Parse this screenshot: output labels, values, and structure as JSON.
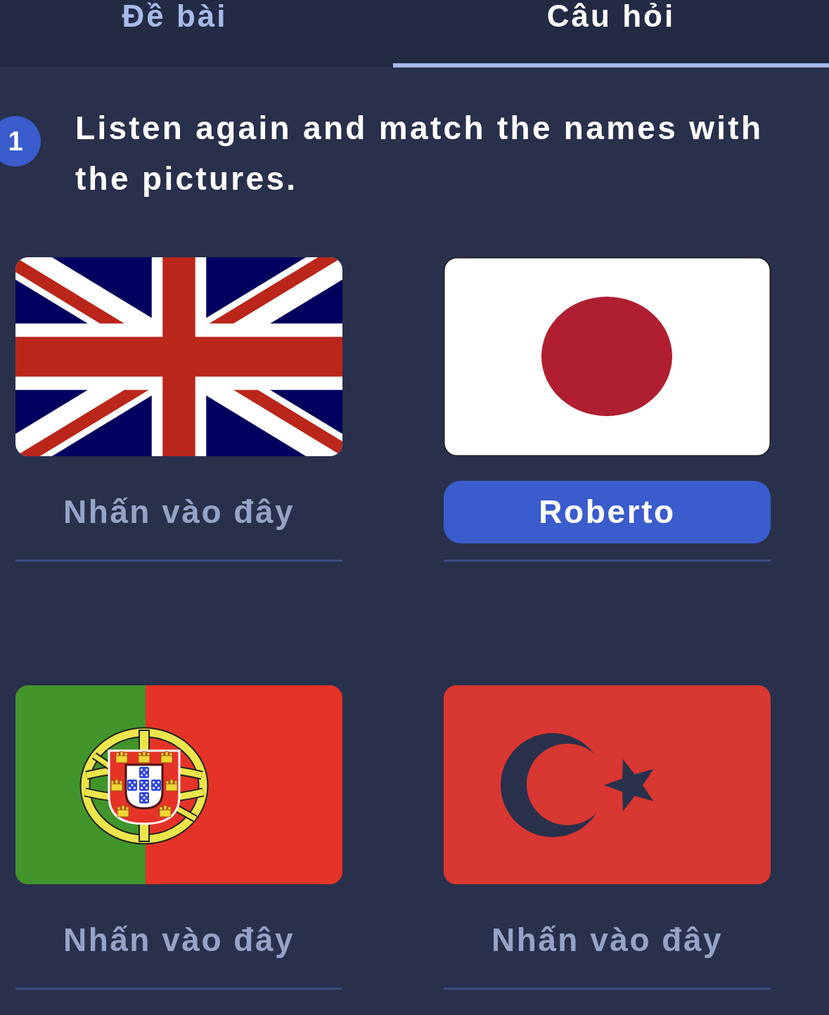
{
  "tabs": [
    {
      "label": "Đề bài",
      "selected": false
    },
    {
      "label": "Câu hỏi",
      "selected": true
    }
  ],
  "question": {
    "number": "1",
    "text": "Listen again and match the names with the pictures."
  },
  "items": [
    {
      "kind": "union-jack",
      "answer": {
        "placeholder": "Nhấn vào đây"
      }
    },
    {
      "kind": "red-disc",
      "answer": {
        "value": "Roberto"
      }
    },
    {
      "kind": "armillary-shield",
      "answer": {
        "placeholder": "Nhấn vào đây"
      }
    },
    {
      "kind": "crescent-star",
      "answer": {
        "placeholder": "Nhấn vào đây"
      }
    }
  ]
}
